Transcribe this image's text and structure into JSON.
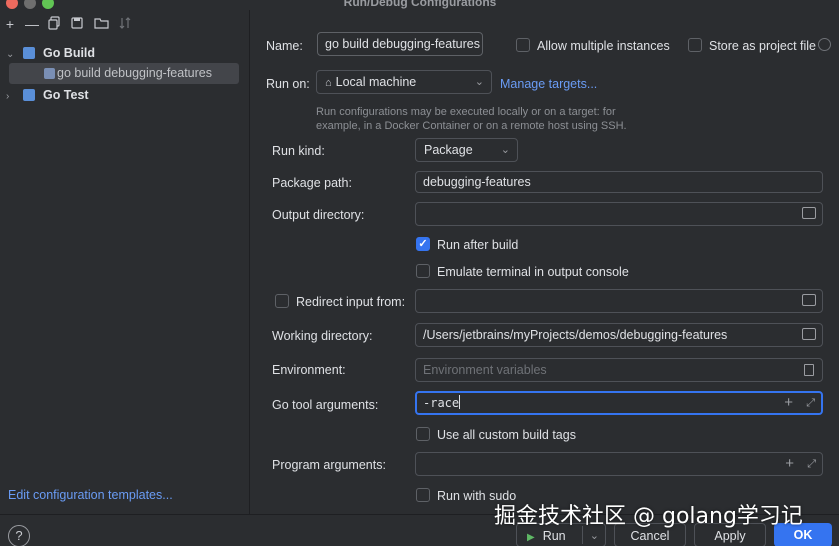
{
  "window": {
    "title": "Run/Debug Configurations"
  },
  "toolbar": {
    "add": "+",
    "remove": "—"
  },
  "tree": {
    "groups": [
      {
        "label": "Go Build",
        "expanded": true
      },
      {
        "label": "Go Test",
        "expanded": false
      }
    ],
    "selected_item": "go build debugging-features"
  },
  "left_footer": {
    "edit_templates": "Edit configuration templates..."
  },
  "form": {
    "name_label": "Name:",
    "name_value": "go build debugging-features",
    "allow_multiple_label": "Allow multiple instances",
    "store_project_label": "Store as project file",
    "run_on_label": "Run on:",
    "run_on_value": "Local machine",
    "manage_targets": "Manage targets...",
    "run_on_hint_1": "Run configurations may be executed locally or on a target: for",
    "run_on_hint_2": "example, in a Docker Container or on a remote host using SSH.",
    "run_kind_label": "Run kind:",
    "run_kind_value": "Package",
    "package_path_label": "Package path:",
    "package_path_value": "debugging-features",
    "output_dir_label": "Output directory:",
    "output_dir_value": "",
    "run_after_build_label": "Run after build",
    "run_after_build_checked": true,
    "emulate_terminal_label": "Emulate terminal in output console",
    "redirect_input_label": "Redirect input from:",
    "working_dir_label": "Working directory:",
    "working_dir_value": "/Users/jetbrains/myProjects/demos/debugging-features",
    "environment_label": "Environment:",
    "environment_placeholder": "Environment variables",
    "go_tool_args_label": "Go tool arguments:",
    "go_tool_args_value": "-race",
    "custom_tags_label": "Use all custom build tags",
    "program_args_label": "Program arguments:",
    "run_with_sudo_label": "Run with sudo"
  },
  "footer": {
    "help": "?",
    "run": "Run",
    "cancel": "Cancel",
    "apply": "Apply",
    "ok": "OK"
  },
  "watermark": "掘金技术社区 @ golang学习记",
  "colors": {
    "accent": "#3574f0",
    "link": "#6a9cf5",
    "bg": "#2b2d30"
  }
}
